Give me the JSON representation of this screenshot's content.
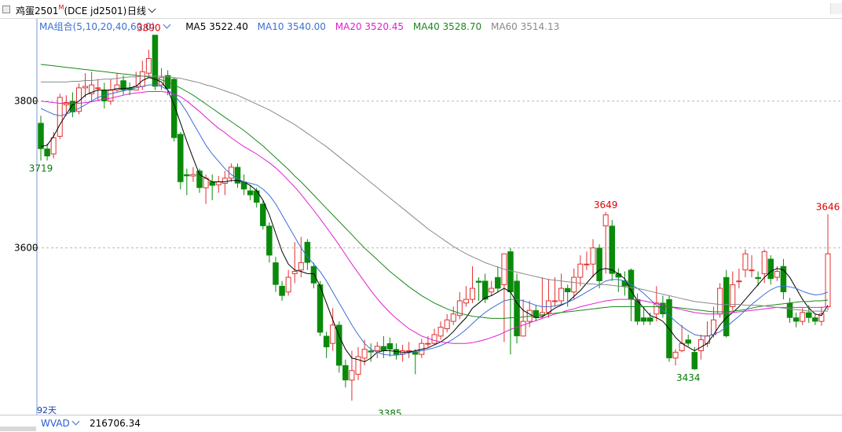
{
  "header": {
    "instrument": "鸡蛋2501",
    "flag": "M",
    "code": "(DCE jd2501)",
    "period": "日线"
  },
  "ma_legend": {
    "group": "MA组合(5,10,20,40,60,0)",
    "items": [
      {
        "label": "MA5 3522.40",
        "color": "#000000"
      },
      {
        "label": "MA10 3540.00",
        "color": "#3b6fd6"
      },
      {
        "label": "MA20 3520.45",
        "color": "#e020d0"
      },
      {
        "label": "MA40 3528.70",
        "color": "#1a8a1a"
      },
      {
        "label": "MA60 3514.13",
        "color": "#8a8a8a"
      }
    ]
  },
  "footer": {
    "days": "92天",
    "indicator": "WVAD",
    "value": "216706.34"
  },
  "chart_data": {
    "type": "candlestick",
    "ylim": [
      3375,
      3912
    ],
    "ytick_labels": [
      "3800",
      "3600"
    ],
    "ytick_values": [
      3800,
      3600
    ],
    "up_color": "#e03030",
    "down_color": "#0a8a0a",
    "annotations": [
      {
        "text": "3890",
        "bar": 17,
        "value": 3890,
        "color": "#e00000",
        "pos": "above"
      },
      {
        "text": "3719",
        "bar": 0,
        "value": 3719,
        "color": "#0a7a0a",
        "pos": "below"
      },
      {
        "text": "3649",
        "bar": 89,
        "value": 3649,
        "color": "#e00000",
        "pos": "above"
      },
      {
        "text": "3385",
        "bar": 55,
        "value": 3385,
        "color": "#0a7a0a",
        "pos": "below"
      },
      {
        "text": "3434",
        "bar": 102,
        "value": 3434,
        "color": "#0a7a0a",
        "pos": "below"
      },
      {
        "text": "3646",
        "bar": 124,
        "value": 3646,
        "color": "#e00000",
        "pos": "above"
      }
    ],
    "candles": [
      [
        3770,
        3735,
        3780,
        3719
      ],
      [
        3735,
        3725,
        3742,
        3719
      ],
      [
        3728,
        3750,
        3758,
        3722
      ],
      [
        3752,
        3805,
        3810,
        3748
      ],
      [
        3795,
        3798,
        3808,
        3780
      ],
      [
        3800,
        3785,
        3812,
        3778
      ],
      [
        3786,
        3818,
        3824,
        3782
      ],
      [
        3818,
        3820,
        3838,
        3805
      ],
      [
        3810,
        3822,
        3840,
        3800
      ],
      [
        3818,
        3818,
        3830,
        3800
      ],
      [
        3815,
        3800,
        3825,
        3790
      ],
      [
        3800,
        3815,
        3830,
        3795
      ],
      [
        3815,
        3822,
        3838,
        3812
      ],
      [
        3828,
        3815,
        3835,
        3808
      ],
      [
        3818,
        3815,
        3825,
        3808
      ],
      [
        3815,
        3820,
        3840,
        3815
      ],
      [
        3820,
        3840,
        3855,
        3815
      ],
      [
        3838,
        3858,
        3870,
        3832
      ],
      [
        3890,
        3820,
        3890,
        3815
      ],
      [
        3822,
        3832,
        3845,
        3815
      ],
      [
        3835,
        3817,
        3842,
        3808
      ],
      [
        3830,
        3750,
        3832,
        3745
      ],
      [
        3755,
        3690,
        3758,
        3680
      ],
      [
        3700,
        3698,
        3708,
        3672
      ],
      [
        3698,
        3700,
        3710,
        3690
      ],
      [
        3705,
        3682,
        3708,
        3675
      ],
      [
        3682,
        3695,
        3700,
        3660
      ],
      [
        3690,
        3685,
        3700,
        3665
      ],
      [
        3686,
        3690,
        3698,
        3675
      ],
      [
        3688,
        3695,
        3705,
        3672
      ],
      [
        3695,
        3710,
        3715,
        3690
      ],
      [
        3710,
        3688,
        3715,
        3682
      ],
      [
        3690,
        3680,
        3700,
        3672
      ],
      [
        3678,
        3672,
        3686,
        3665
      ],
      [
        3678,
        3662,
        3682,
        3655
      ],
      [
        3660,
        3630,
        3665,
        3625
      ],
      [
        3630,
        3590,
        3635,
        3580
      ],
      [
        3580,
        3550,
        3588,
        3540
      ],
      [
        3548,
        3535,
        3555,
        3528
      ],
      [
        3540,
        3560,
        3570,
        3535
      ],
      [
        3565,
        3568,
        3608,
        3552
      ],
      [
        3570,
        3580,
        3615,
        3560
      ],
      [
        3608,
        3580,
        3612,
        3570
      ],
      [
        3575,
        3552,
        3580,
        3545
      ],
      [
        3550,
        3485,
        3555,
        3480
      ],
      [
        3480,
        3465,
        3486,
        3450
      ],
      [
        3470,
        3495,
        3518,
        3460
      ],
      [
        3495,
        3440,
        3500,
        3430
      ],
      [
        3440,
        3420,
        3448,
        3410
      ],
      [
        3420,
        3433,
        3460,
        3392
      ],
      [
        3428,
        3452,
        3465,
        3420
      ],
      [
        3450,
        3462,
        3475,
        3440
      ],
      [
        3460,
        3458,
        3470,
        3445
      ],
      [
        3460,
        3466,
        3472,
        3450
      ],
      [
        3466,
        3460,
        3480,
        3450
      ],
      [
        3470,
        3462,
        3478,
        3452
      ],
      [
        3462,
        3455,
        3470,
        3448
      ],
      [
        3456,
        3460,
        3468,
        3445
      ],
      [
        3460,
        3460,
        3472,
        3450
      ],
      [
        3458,
        3455,
        3462,
        3428
      ],
      [
        3455,
        3470,
        3476,
        3450
      ],
      [
        3470,
        3470,
        3480,
        3465
      ],
      [
        3470,
        3482,
        3490,
        3468
      ],
      [
        3480,
        3492,
        3500,
        3475
      ],
      [
        3490,
        3502,
        3510,
        3485
      ],
      [
        3500,
        3510,
        3520,
        3495
      ],
      [
        3508,
        3528,
        3540,
        3503
      ],
      [
        3525,
        3530,
        3548,
        3520
      ],
      [
        3530,
        3545,
        3575,
        3525
      ],
      [
        3555,
        3553,
        3560,
        3528
      ],
      [
        3555,
        3530,
        3565,
        3525
      ],
      [
        3540,
        3545,
        3555,
        3535
      ],
      [
        3560,
        3545,
        3575,
        3540
      ],
      [
        3550,
        3592,
        3592,
        3472
      ],
      [
        3595,
        3540,
        3600,
        3455
      ],
      [
        3555,
        3480,
        3565,
        3470
      ],
      [
        3480,
        3500,
        3530,
        3480
      ],
      [
        3500,
        3515,
        3528,
        3492
      ],
      [
        3515,
        3505,
        3522,
        3500
      ],
      [
        3508,
        3512,
        3560,
        3505
      ],
      [
        3512,
        3528,
        3558,
        3505
      ],
      [
        3528,
        3528,
        3560,
        3520
      ],
      [
        3528,
        3545,
        3565,
        3522
      ],
      [
        3545,
        3540,
        3550,
        3520
      ],
      [
        3540,
        3560,
        3572,
        3530
      ],
      [
        3560,
        3578,
        3590,
        3548
      ],
      [
        3578,
        3578,
        3595,
        3570
      ],
      [
        3578,
        3600,
        3612,
        3560
      ],
      [
        3600,
        3555,
        3605,
        3545
      ],
      [
        3630,
        3645,
        3649,
        3565
      ],
      [
        3630,
        3565,
        3638,
        3555
      ],
      [
        3565,
        3560,
        3572,
        3540
      ],
      [
        3555,
        3548,
        3568,
        3535
      ],
      [
        3570,
        3530,
        3572,
        3500
      ],
      [
        3530,
        3500,
        3538,
        3495
      ],
      [
        3505,
        3500,
        3520,
        3495
      ],
      [
        3505,
        3500,
        3512,
        3495
      ],
      [
        3510,
        3525,
        3548,
        3500
      ],
      [
        3525,
        3510,
        3535,
        3505
      ],
      [
        3530,
        3450,
        3535,
        3445
      ],
      [
        3450,
        3458,
        3462,
        3440
      ],
      [
        3460,
        3470,
        3495,
        3458
      ],
      [
        3475,
        3470,
        3482,
        3466
      ],
      [
        3458,
        3435,
        3465,
        3434
      ],
      [
        3460,
        3475,
        3482,
        3448
      ],
      [
        3470,
        3480,
        3500,
        3465
      ],
      [
        3482,
        3502,
        3520,
        3478
      ],
      [
        3510,
        3545,
        3552,
        3505
      ],
      [
        3560,
        3480,
        3570,
        3478
      ],
      [
        3520,
        3550,
        3568,
        3515
      ],
      [
        3555,
        3555,
        3572,
        3545
      ],
      [
        3570,
        3592,
        3598,
        3560
      ],
      [
        3570,
        3570,
        3590,
        3560
      ],
      [
        3560,
        3558,
        3568,
        3548
      ],
      [
        3565,
        3595,
        3598,
        3552
      ],
      [
        3585,
        3558,
        3590,
        3550
      ],
      [
        3560,
        3568,
        3575,
        3555
      ],
      [
        3575,
        3540,
        3585,
        3530
      ],
      [
        3525,
        3505,
        3532,
        3498
      ],
      [
        3505,
        3500,
        3512,
        3492
      ],
      [
        3500,
        3512,
        3518,
        3495
      ],
      [
        3512,
        3505,
        3522,
        3498
      ],
      [
        3505,
        3500,
        3510,
        3495
      ],
      [
        3500,
        3510,
        3520,
        3494
      ],
      [
        3520,
        3592,
        3646,
        3515
      ]
    ],
    "ma_values": {
      "MA5": [
        3738,
        3740,
        3752,
        3768,
        3782,
        3795,
        3800,
        3808,
        3812,
        3815,
        3815,
        3815,
        3817,
        3817,
        3818,
        3820,
        3828,
        3832,
        3830,
        3826,
        3815,
        3795,
        3770,
        3745,
        3722,
        3700,
        3695,
        3690,
        3690,
        3690,
        3692,
        3692,
        3690,
        3685,
        3678,
        3665,
        3645,
        3620,
        3595,
        3578,
        3570,
        3568,
        3565,
        3565,
        3548,
        3525,
        3502,
        3480,
        3462,
        3450,
        3448,
        3445,
        3450,
        3458,
        3460,
        3460,
        3459,
        3458,
        3458,
        3460,
        3462,
        3464,
        3468,
        3472,
        3478,
        3486,
        3496,
        3505,
        3518,
        3525,
        3532,
        3535,
        3540,
        3545,
        3540,
        3525,
        3515,
        3510,
        3505,
        3506,
        3512,
        3518,
        3522,
        3526,
        3534,
        3542,
        3552,
        3562,
        3570,
        3572,
        3570,
        3565,
        3558,
        3542,
        3528,
        3518,
        3508,
        3505,
        3500,
        3490,
        3478,
        3470,
        3465,
        3460,
        3465,
        3470,
        3482,
        3495,
        3505,
        3512,
        3520,
        3530,
        3540,
        3550,
        3560,
        3568,
        3572,
        3570,
        3560,
        3545,
        3530,
        3518,
        3510,
        3508,
        3522
      ],
      "MA10": [
        3790,
        3786,
        3782,
        3780,
        3782,
        3786,
        3790,
        3795,
        3800,
        3805,
        3808,
        3810,
        3812,
        3814,
        3816,
        3818,
        3820,
        3822,
        3822,
        3820,
        3815,
        3808,
        3798,
        3785,
        3770,
        3755,
        3740,
        3728,
        3718,
        3708,
        3700,
        3694,
        3690,
        3688,
        3686,
        3680,
        3672,
        3660,
        3645,
        3630,
        3615,
        3600,
        3588,
        3578,
        3568,
        3555,
        3540,
        3525,
        3510,
        3495,
        3482,
        3470,
        3462,
        3458,
        3455,
        3454,
        3454,
        3455,
        3457,
        3459,
        3460,
        3462,
        3464,
        3467,
        3471,
        3476,
        3482,
        3489,
        3497,
        3505,
        3512,
        3518,
        3523,
        3528,
        3530,
        3530,
        3528,
        3525,
        3522,
        3520,
        3520,
        3521,
        3523,
        3526,
        3530,
        3535,
        3540,
        3545,
        3550,
        3555,
        3557,
        3557,
        3555,
        3550,
        3545,
        3538,
        3530,
        3522,
        3515,
        3508,
        3500,
        3493,
        3487,
        3482,
        3480,
        3480,
        3482,
        3486,
        3492,
        3500,
        3507,
        3515,
        3523,
        3530,
        3537,
        3543,
        3547,
        3548,
        3547,
        3545,
        3541,
        3538,
        3536,
        3537,
        3540
      ],
      "MA20": [
        3800,
        3799,
        3798,
        3797,
        3797,
        3797,
        3797,
        3798,
        3799,
        3801,
        3803,
        3804,
        3806,
        3808,
        3810,
        3811,
        3812,
        3813,
        3813,
        3813,
        3812,
        3810,
        3806,
        3800,
        3793,
        3786,
        3778,
        3770,
        3763,
        3757,
        3750,
        3744,
        3738,
        3733,
        3728,
        3722,
        3716,
        3709,
        3701,
        3692,
        3683,
        3673,
        3662,
        3651,
        3640,
        3628,
        3616,
        3604,
        3591,
        3578,
        3566,
        3554,
        3542,
        3531,
        3521,
        3512,
        3504,
        3497,
        3490,
        3485,
        3480,
        3477,
        3474,
        3472,
        3471,
        3470,
        3470,
        3470,
        3471,
        3473,
        3475,
        3478,
        3481,
        3485,
        3489,
        3492,
        3495,
        3498,
        3501,
        3504,
        3507,
        3510,
        3512,
        3515,
        3517,
        3520,
        3522,
        3524,
        3526,
        3528,
        3529,
        3530,
        3530,
        3530,
        3529,
        3528,
        3526,
        3524,
        3522,
        3520,
        3518,
        3516,
        3514,
        3512,
        3511,
        3510,
        3510,
        3510,
        3511,
        3512,
        3513,
        3514,
        3515,
        3516,
        3517,
        3518,
        3519,
        3519,
        3519,
        3519,
        3519,
        3519,
        3519,
        3519,
        3520
      ],
      "MA40": [
        3850,
        3849,
        3848,
        3847,
        3846,
        3845,
        3844,
        3843,
        3842,
        3841,
        3840,
        3839,
        3838,
        3837,
        3836,
        3835,
        3834,
        3833,
        3831,
        3829,
        3826,
        3822,
        3818,
        3813,
        3808,
        3802,
        3796,
        3790,
        3784,
        3778,
        3772,
        3766,
        3760,
        3753,
        3746,
        3739,
        3731,
        3723,
        3715,
        3707,
        3698,
        3690,
        3681,
        3672,
        3663,
        3654,
        3645,
        3636,
        3627,
        3618,
        3609,
        3600,
        3592,
        3584,
        3576,
        3568,
        3561,
        3554,
        3547,
        3541,
        3535,
        3530,
        3525,
        3521,
        3517,
        3514,
        3511,
        3509,
        3507,
        3506,
        3505,
        3504,
        3504,
        3504,
        3505,
        3505,
        3506,
        3507,
        3508,
        3509,
        3510,
        3511,
        3512,
        3513,
        3514,
        3515,
        3516,
        3517,
        3518,
        3519,
        3520,
        3520,
        3520,
        3520,
        3520,
        3520,
        3520,
        3520,
        3520,
        3520,
        3519,
        3518,
        3517,
        3516,
        3515,
        3514,
        3513,
        3513,
        3513,
        3514,
        3515,
        3516,
        3518,
        3520,
        3521,
        3522,
        3523,
        3524,
        3525,
        3526,
        3527,
        3527,
        3528,
        3528,
        3529
      ],
      "MA60": [
        3826,
        3826,
        3826,
        3826,
        3826,
        3827,
        3827,
        3828,
        3828,
        3829,
        3830,
        3830,
        3831,
        3832,
        3833,
        3833,
        3834,
        3834,
        3834,
        3834,
        3833,
        3832,
        3831,
        3829,
        3827,
        3825,
        3822,
        3820,
        3817,
        3814,
        3811,
        3808,
        3804,
        3800,
        3796,
        3792,
        3788,
        3783,
        3778,
        3773,
        3768,
        3762,
        3756,
        3750,
        3744,
        3738,
        3731,
        3724,
        3717,
        3710,
        3703,
        3696,
        3689,
        3682,
        3675,
        3668,
        3661,
        3654,
        3647,
        3640,
        3633,
        3626,
        3620,
        3614,
        3608,
        3602,
        3597,
        3592,
        3588,
        3584,
        3580,
        3577,
        3574,
        3571,
        3569,
        3567,
        3565,
        3563,
        3561,
        3559,
        3557,
        3556,
        3555,
        3554,
        3553,
        3552,
        3551,
        3551,
        3550,
        3550,
        3549,
        3548,
        3547,
        3546,
        3545,
        3543,
        3541,
        3539,
        3537,
        3535,
        3533,
        3531,
        3529,
        3527,
        3526,
        3525,
        3524,
        3523,
        3523,
        3523,
        3523,
        3522,
        3522,
        3522,
        3521,
        3520,
        3519,
        3518,
        3517,
        3516,
        3515,
        3514,
        3514,
        3514,
        3514
      ]
    }
  }
}
